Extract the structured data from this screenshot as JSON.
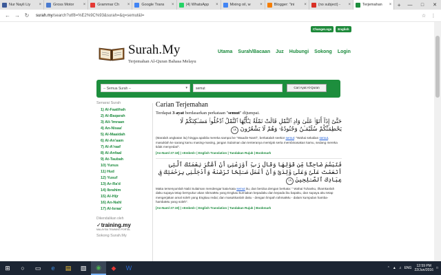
{
  "browser": {
    "tabs": [
      {
        "label": "Nur Nayli Liy",
        "color": "#3b5998",
        "active": false
      },
      {
        "label": "Gross Motor",
        "color": "#4a7bd0",
        "active": false
      },
      {
        "label": "Grammar Ch",
        "color": "#e53935",
        "active": false
      },
      {
        "label": "Google Trans",
        "color": "#4285f4",
        "active": false
      },
      {
        "label": "(4) WhatsApp",
        "color": "#25d366",
        "active": false
      },
      {
        "label": "Mixing oil, w",
        "color": "#4285f4",
        "active": false
      },
      {
        "label": "Blogger: \"ini",
        "color": "#f57d00",
        "active": false
      },
      {
        "label": "(no subject) -",
        "color": "#d93025",
        "active": false
      },
      {
        "label": "Terjemahan",
        "color": "#1d8e3d",
        "active": true
      }
    ],
    "new_tab": "+",
    "url_host": "surah.my",
    "url_path": "/search?utf8=%E2%9C%93&surah=&q=semut&l="
  },
  "site": {
    "top_buttons": [
      "ChangeLogs",
      "English"
    ],
    "brand": "Surah.My",
    "tagline": "Terjemahan Al-Quran Bahasa Melayu",
    "nav": [
      "Utama",
      "Surah/Bacaan",
      "Juz",
      "Hubungi",
      "Sokong",
      "Login"
    ],
    "search": {
      "select_value": "-- Semua Surah --",
      "query": "semut",
      "button": "Cari Ayat Al-Quran"
    },
    "sidebar": {
      "heading": "Senarai Surah",
      "items": [
        "1) Al-Faatihah",
        "2) Al-Baqarah",
        "3) Ali-'Imraan",
        "4) An-Nisaa'",
        "5) Al-Maaidah",
        "6) Al-An'aam",
        "7) Al-A'raaf",
        "8) Al-Anfaal",
        "9) At-Taubah",
        "10) Yunus",
        "11) Hud",
        "12) Yusuf",
        "13) Ar-Ra'd",
        "14) Ibrahim",
        "15) Al-Hijr",
        "16) An-Nahl",
        "17) Al-Israa'"
      ],
      "sponsor_heading": "Dikendalikan oleh",
      "sponsor_name": "training.my",
      "sponsor_sub": "MALAYSIA TRAINING PORTAL",
      "sokong_heading": "Sokong Surah.My"
    },
    "content": {
      "title": "Carian Terjemahan",
      "summary_pre": "Terdapat ",
      "summary_count": "3 ayat",
      "summary_mid": " berdasarkan perkataan \"",
      "summary_term": "semut",
      "summary_post": "\" dijumpai.",
      "results": [
        {
          "arabic": "حَتَّىٰٓ إِذَآ أَتَوْا۟ عَلَىٰ وَادِ ٱلنَّمْلِ قَالَتْ نَمْلَةٌ يَـٰٓأَيُّهَا ٱلنَّمْلُ ٱدْخُلُوا۟ مَسَـٰكِنَكُمْ لَا يَحْطِمَنَّكُمْ سُلَيْمَـٰنُ وَجُنُودُهُۥ وَهُمْ لَا يَشْعُرُونَ",
          "ayah_no": "١٨",
          "trans_1": "(Maralah angkatan itu) hingga apabila mereka sampai ke \"Waadin-Naml\", berkatalah seekor ",
          "trans_hl_1": "semut",
          "trans_2": ": \"Wahai sekalian ",
          "trans_hl_2": "semut",
          "trans_3": ", masuklah ke sarang kamu masing-masing, jangan Sulaiman dan tenteranya memijak serta membinasakan kamu, sedang mereka tidak menyedari\".",
          "links": "[An-Naml 27:18] | «Embed» | English Translation | Tandakan Rujuk | Bookmark"
        },
        {
          "arabic": "فَتَبَسَّمَ ضَاحِكًا مِّن قَوْلِهَا وَقَالَ رَبِّ أَوْزِعْنِىٓ أَنْ أَشْكُرَ نِعْمَتَكَ ٱلَّتِىٓ أَنْعَمْتَ عَلَىَّ وَعَلَىٰ وَٰلِدَىَّ وَأَنْ أَعْمَلَ صَـٰلِحًا تَرْضَىٰهُ وَأَدْخِلْنِى بِرَحْمَتِكَ فِى عِبَادِكَ ٱلصَّـٰلِحِينَ",
          "ayah_no": "١٩",
          "trans_1": "Maka tersenyumlah Nabi Sulaiman mendengar kata-kata ",
          "trans_hl_1": "semut",
          "trans_2": " itu, dan berdoa dengan berkata: \" Wahai Tuhanku, ilhamkanlah daku supaya tetap bersyukur akan nikmatMu yang Engkau kurniakan kepadaku dan kepada ibu bapaku, dan supaya aku tetap mengerjakan amal soleh yang Engkau redai; dan masukkanlah daku - dengan limpah rahmatMu - dalam kumpulan hamba-hambaMu yang soleh\".",
          "trans_hl_2": "",
          "trans_3": "",
          "links": "[An-Naml 27:19] | «Embed» | English Translation | Tandakan Rujuk | Bookmark"
        }
      ]
    }
  },
  "taskbar": {
    "time": "12:59 PM",
    "date": "22/Jun/2016",
    "lang": "ENG"
  }
}
